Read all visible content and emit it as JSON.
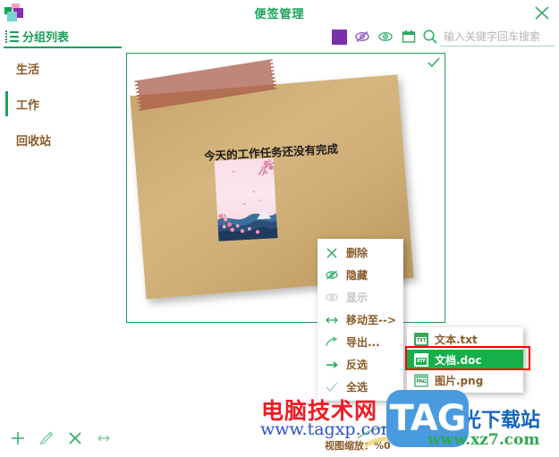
{
  "window": {
    "title": "便签管理",
    "logo_icon": "app-logo-squares",
    "close_icon": "close-icon"
  },
  "toolbar": {
    "group_list_label": "分组列表",
    "group_list_icon": "list-icon",
    "color_swatch_color": "#7b2fa8",
    "icons": [
      {
        "name": "color-swatch",
        "icon": "color-square-icon"
      },
      {
        "name": "hide-icon",
        "icon": "eye-slash-icon"
      },
      {
        "name": "show-icon",
        "icon": "eye-icon"
      },
      {
        "name": "save-icon",
        "icon": "calendar-save-icon"
      }
    ],
    "search": {
      "icon": "search-icon",
      "placeholder": "输入关键字回车搜索",
      "value": ""
    }
  },
  "sidebar": {
    "items": [
      {
        "label": "生活",
        "selected": false
      },
      {
        "label": "工作",
        "selected": true
      },
      {
        "label": "回收站",
        "selected": false
      }
    ]
  },
  "note_panel": {
    "check_icon": "checkmark-icon",
    "note": {
      "text": "今天的工作任务还没有完成",
      "background_color": "#cfae76",
      "tape_color": "#a85846",
      "image_name": "cherry-blossom-image"
    }
  },
  "context_menu": {
    "items": [
      {
        "label": "删除",
        "icon": "close-x-icon",
        "disabled": false
      },
      {
        "label": "隐藏",
        "icon": "eye-slash-icon",
        "disabled": false
      },
      {
        "label": "显示",
        "icon": "eye-icon",
        "disabled": true
      },
      {
        "label": "移动至-->",
        "icon": "left-right-arrow-icon",
        "disabled": false
      },
      {
        "label": "导出...",
        "icon": "share-arrow-icon",
        "disabled": false
      },
      {
        "label": "反选",
        "icon": "right-arrow-icon",
        "disabled": false
      },
      {
        "label": "全选",
        "icon": "check-icon",
        "disabled": false
      }
    ]
  },
  "submenu": {
    "items": [
      {
        "label": "文本.txt",
        "badge": "TXT",
        "active": false
      },
      {
        "label": "文档.doc",
        "badge": "RTF",
        "active": true
      },
      {
        "label": "图片.png",
        "badge": "PNG",
        "active": false
      }
    ],
    "highlight_color": "#ff0000",
    "active_color": "#16b04b"
  },
  "bottom_bar": {
    "icons": [
      {
        "name": "add-note-button",
        "icon": "plus-icon"
      },
      {
        "name": "edit-note-button",
        "icon": "pencil-icon"
      },
      {
        "name": "delete-note-button",
        "icon": "close-x-icon"
      },
      {
        "name": "move-note-button",
        "icon": "left-right-arrow-icon"
      }
    ],
    "zoom_status": "视图缩放：%0"
  },
  "watermarks": {
    "line1": "电脑技术网",
    "line2": "www.tagxp.com",
    "tag_logo": "TAG",
    "line3": "光下载站",
    "line4": "www.xz7.com"
  }
}
